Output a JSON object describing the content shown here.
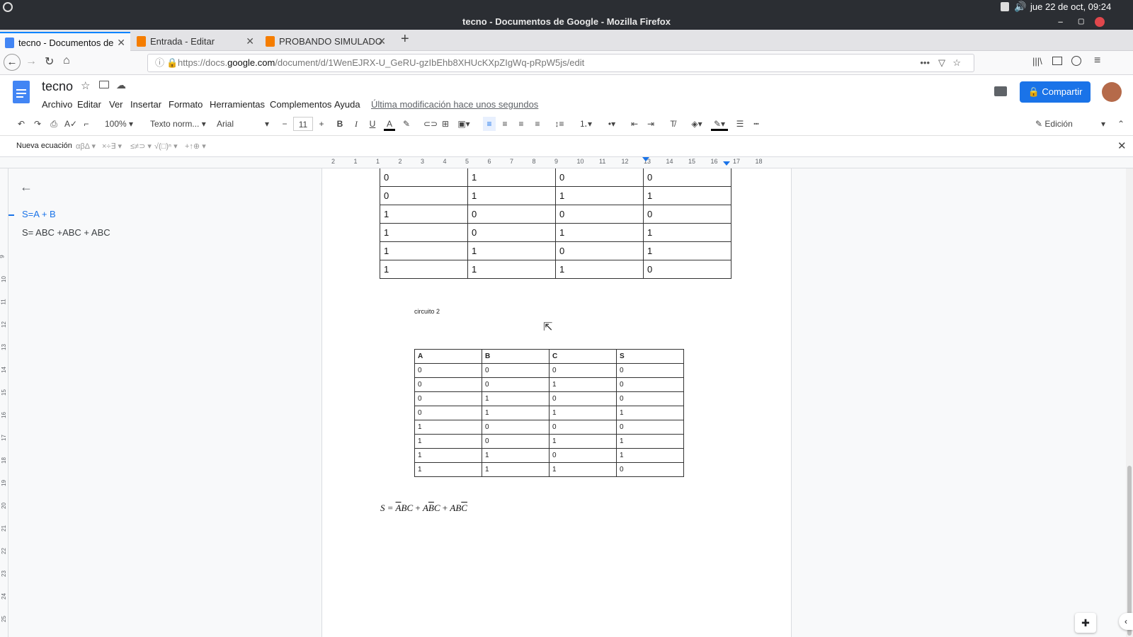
{
  "system": {
    "datetime": "jue 22 de oct, 09:24"
  },
  "window": {
    "title": "tecno - Documentos de Google - Mozilla Firefox"
  },
  "tabs": [
    {
      "label": "tecno - Documentos de",
      "color": "#4285f4"
    },
    {
      "label": "Entrada - Editar",
      "color": "#f57d00"
    },
    {
      "label": "PROBANDO SIMULADO",
      "color": "#f57d00"
    }
  ],
  "url": {
    "prefix": "https://docs.",
    "host": "google.com",
    "path": "/document/d/1WenEJRX-U_GeRU-gzIbEhb8XHUcKXpZIgWq-pRpW5js/edit"
  },
  "doc": {
    "title": "tecno",
    "menu": [
      "Archivo",
      "Editar",
      "Ver",
      "Insertar",
      "Formato",
      "Herramientas",
      "Complementos",
      "Ayuda"
    ],
    "last_edit": "Última modificación hace unos segundos",
    "share_label": "Compartir"
  },
  "toolbar": {
    "zoom": "100%",
    "style": "Texto norm...",
    "font": "Arial",
    "font_size": "11",
    "mode": "Edición"
  },
  "eqbar": {
    "new_equation": "Nueva ecuación",
    "groups": [
      "αβΔ",
      "×÷∃",
      "≤≠⊃",
      "√(□)ⁿ",
      "+↑⊕"
    ]
  },
  "ruler": {
    "labels": [
      "2",
      "1",
      "1",
      "2",
      "3",
      "4",
      "5",
      "6",
      "7",
      "8",
      "9",
      "10",
      "11",
      "12",
      "13",
      "14",
      "15",
      "16",
      "17",
      "18"
    ],
    "vlabels": [
      "9",
      "10",
      "11",
      "12",
      "13",
      "14",
      "15",
      "16",
      "17",
      "18",
      "19",
      "20",
      "21",
      "22",
      "23",
      "24",
      "25"
    ]
  },
  "outline": {
    "items": [
      "S=A + B",
      "S= ABC +ABC + ABC"
    ]
  },
  "table1": [
    [
      "0",
      "1",
      "0",
      "0"
    ],
    [
      "0",
      "1",
      "1",
      "1"
    ],
    [
      "1",
      "0",
      "0",
      "0"
    ],
    [
      "1",
      "0",
      "1",
      "1"
    ],
    [
      "1",
      "1",
      "0",
      "1"
    ],
    [
      "1",
      "1",
      "1",
      "0"
    ]
  ],
  "circuit_label": "circuito 2",
  "table2": {
    "headers": [
      "A",
      "B",
      "C",
      "S"
    ],
    "rows": [
      [
        "0",
        "0",
        "0",
        "0"
      ],
      [
        "0",
        "0",
        "1",
        "0"
      ],
      [
        "0",
        "1",
        "0",
        "0"
      ],
      [
        "0",
        "1",
        "1",
        "1"
      ],
      [
        "1",
        "0",
        "0",
        "0"
      ],
      [
        "1",
        "0",
        "1",
        "1"
      ],
      [
        "1",
        "1",
        "0",
        "1"
      ],
      [
        "1",
        "1",
        "1",
        "0"
      ]
    ]
  },
  "equation": {
    "lhs": "S =",
    "terms": [
      [
        {
          "t": "A",
          "bar": true
        },
        {
          "t": "BC",
          "bar": false
        }
      ],
      [
        {
          "t": "A",
          "bar": false
        },
        {
          "t": "B",
          "bar": true
        },
        {
          "t": "C",
          "bar": false
        }
      ],
      [
        {
          "t": "AB",
          "bar": false
        },
        {
          "t": "C",
          "bar": true
        }
      ]
    ]
  },
  "colors": {
    "accent": "#1a73e8",
    "docs_blue": "#4285f4"
  }
}
